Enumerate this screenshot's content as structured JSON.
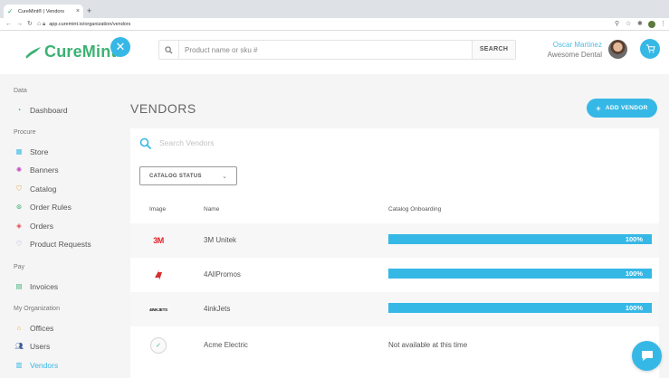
{
  "browser": {
    "tab_title": "CureMint® | Vendors",
    "new_tab": "+",
    "tab_close": "×",
    "url": "app.curemint.io/organization/vendors"
  },
  "header": {
    "logo_text": "CureMint",
    "logo_reg": "®",
    "search_placeholder": "Product name or sku #",
    "search_button": "SEARCH",
    "user_name": "Oscar Martinez",
    "org_name": "Awesome Dental"
  },
  "sidebar": {
    "sections": [
      {
        "title": "Data",
        "items": [
          {
            "label": "Dashboard",
            "icon": "dashboard-icon"
          }
        ]
      },
      {
        "title": "Procure",
        "items": [
          {
            "label": "Store",
            "icon": "store-icon"
          },
          {
            "label": "Banners",
            "icon": "banners-icon"
          },
          {
            "label": "Catalog",
            "icon": "catalog-icon"
          },
          {
            "label": "Order Rules",
            "icon": "order-rules-icon"
          },
          {
            "label": "Orders",
            "icon": "orders-icon"
          },
          {
            "label": "Product Requests",
            "icon": "product-requests-icon"
          }
        ]
      },
      {
        "title": "Pay",
        "items": [
          {
            "label": "Invoices",
            "icon": "invoices-icon"
          }
        ]
      },
      {
        "title": "My Organization",
        "items": [
          {
            "label": "Offices",
            "icon": "offices-icon"
          },
          {
            "label": "Users",
            "icon": "users-icon"
          },
          {
            "label": "Vendors",
            "icon": "vendors-icon",
            "active": true
          }
        ]
      }
    ]
  },
  "main": {
    "title": "VENDORS",
    "add_vendor": "ADD VENDOR",
    "add_vendor_plus": "+",
    "search_placeholder": "Search Vendors",
    "catalog_status": "CATALOG STATUS",
    "columns": [
      "Image",
      "Name",
      "Catalog Onboarding"
    ],
    "rows": [
      {
        "logo": "3M",
        "name": "3M Unitek",
        "progress": 100,
        "progress_label": "100%"
      },
      {
        "logo": "4allpromos-logo",
        "name": "4AllPromos",
        "progress": 100,
        "progress_label": "100%"
      },
      {
        "logo": "4INKJETS",
        "name": "4inkJets",
        "progress": 100,
        "progress_label": "100%"
      },
      {
        "logo": "acme-electric-logo",
        "name": "Acme Electric",
        "status": "Not available at this time"
      }
    ]
  },
  "colors": {
    "accent": "#36b8e6",
    "brand": "#3bb273",
    "progress_track": "#e6e6e6",
    "active_nav": "#36b8e6"
  }
}
